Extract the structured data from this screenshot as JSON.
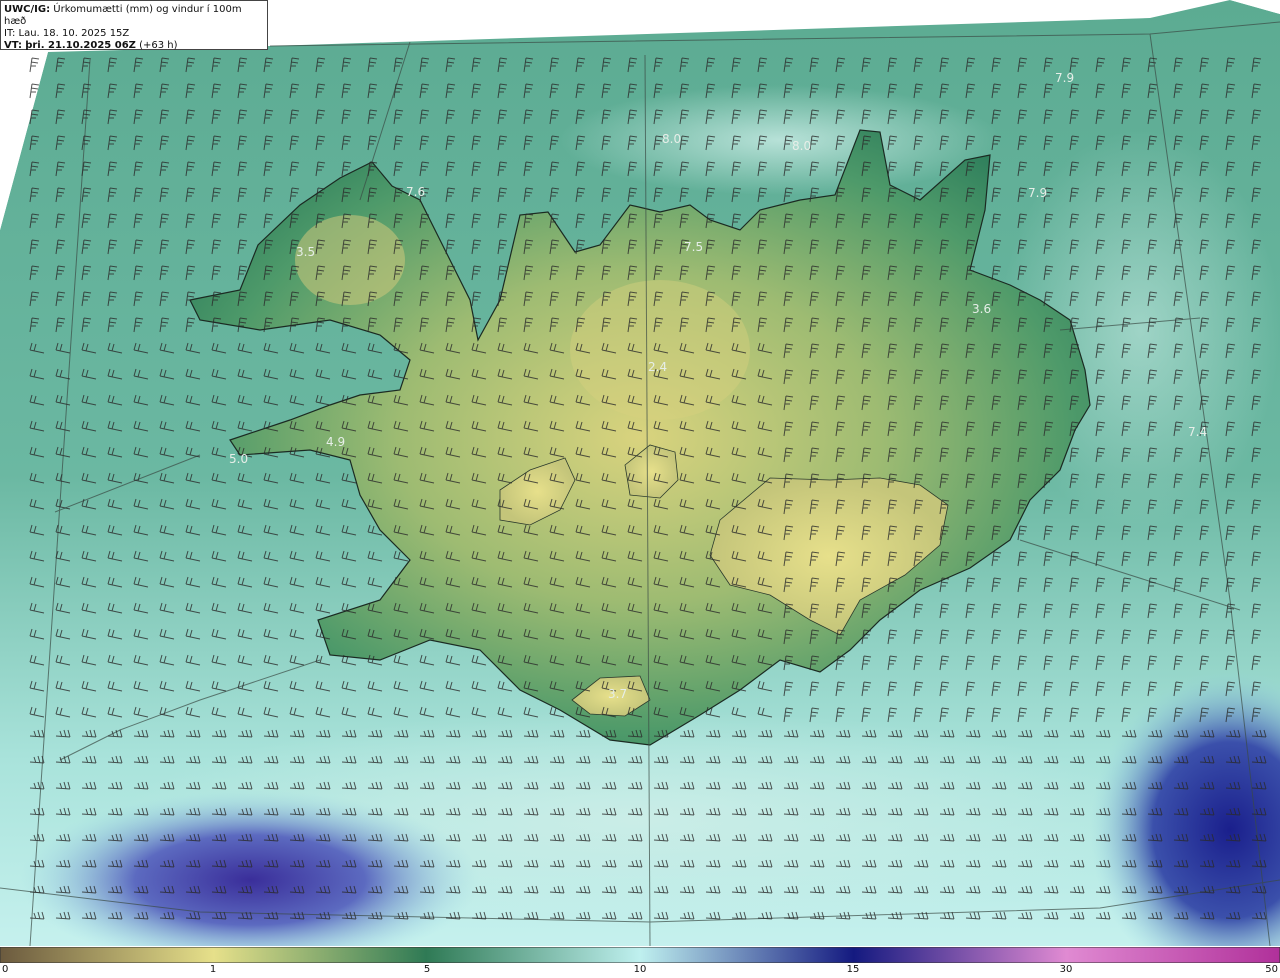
{
  "header": {
    "product": "UWC/IG:",
    "title": "Úrkomumætti (mm) og vindur í 100m hæð",
    "it_line": "IT: Lau. 18. 10. 2025 15Z",
    "vt_prefix": "VT:",
    "vt_value": "þri. 21.10.2025 06Z",
    "vt_offset": "(+63 h)"
  },
  "colorbar": {
    "ticks": [
      "0",
      "1",
      "5",
      "10",
      "15",
      "30",
      "50"
    ],
    "colors": {
      "dry": "#6b5a3e",
      "low": "#e6e08a",
      "mid": "#2f7a55",
      "high": "#bff0ef",
      "heavy": "#141a80",
      "extreme": "#b0309a"
    }
  },
  "map_labels": [
    {
      "text": "7.9"
    },
    {
      "text": "8.0"
    },
    {
      "text": "8.0"
    },
    {
      "text": "7.6"
    },
    {
      "text": "7.9"
    },
    {
      "text": "3.5"
    },
    {
      "text": "7.5"
    },
    {
      "text": "3.6"
    },
    {
      "text": "2.4"
    },
    {
      "text": "4.9"
    },
    {
      "text": "5.0"
    },
    {
      "text": "7.4"
    },
    {
      "text": "3.7"
    }
  ]
}
